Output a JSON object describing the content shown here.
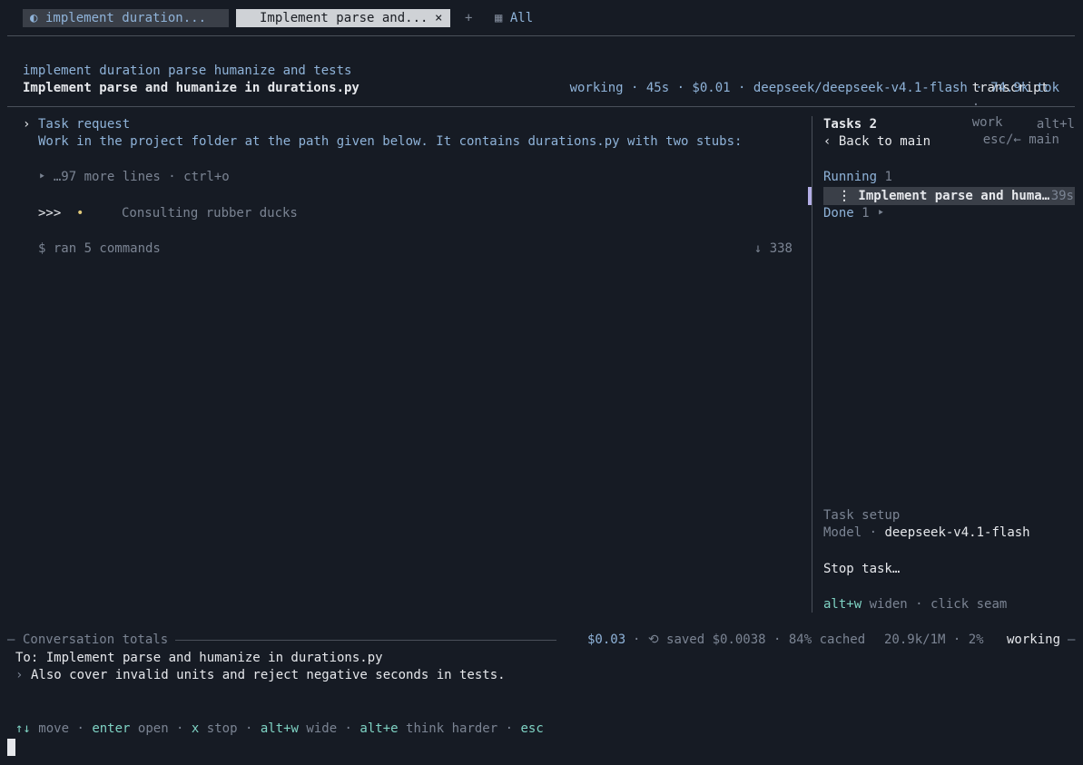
{
  "tabs": [
    {
      "icon": "◐",
      "label": "implement duration..."
    },
    {
      "label": "Implement parse and...",
      "close": "×"
    }
  ],
  "tab_add": "+",
  "tab_all": {
    "icon": "▦",
    "label": "All"
  },
  "header": {
    "task_title": "implement duration parse humanize and tests",
    "task_subtitle": "Implement parse and humanize in durations.py",
    "view_active": "transcript",
    "sep": "·",
    "view_other": "work",
    "back_hint": "esc/← main",
    "status": "working · 45s · $0.01 · deepseek/deepseek-v4.1-flash · 74.9k tok"
  },
  "transcript": {
    "request_marker": "›",
    "request_title": "Task request",
    "request_body": "Work in the project folder at the path given below. It contains durations.py with two stubs:",
    "more_lines": "‣ …97 more lines · ctrl+o",
    "prompt": ">>>",
    "spinner": "•",
    "activity": "Consulting rubber ducks",
    "commands": "$ ran 5 commands",
    "commands_count": "↓ 338"
  },
  "sidebar": {
    "title": "Tasks 2",
    "shortcut": "alt+l",
    "back": "‹ Back to main",
    "running_label": "Running",
    "running_count": "1",
    "running_task": "⋮ Implement parse and huma…",
    "running_time": "39s",
    "done_label": "Done",
    "done_count": "1 ‣",
    "setup_title": "Task setup",
    "model_label": "Model ·",
    "model_value": "deepseek-v4.1-flash",
    "stop": "Stop task…",
    "widen_key": "alt+w",
    "widen_text": "widen · click seam"
  },
  "totals": {
    "label": "Conversation totals",
    "cost": "$0.03",
    "saved": "· ⟲ saved $0.0038 · 84% cached",
    "tokens": "20.9k/1M · 2%",
    "status": "working"
  },
  "composer": {
    "to": "To: Implement parse and humanize in durations.py",
    "marker": "›",
    "message": "Also cover invalid units and reject negative seconds in tests."
  },
  "hints": {
    "move_key": "↑↓",
    "move": "move ·",
    "enter_key": "enter",
    "enter": "open ·",
    "x_key": "x",
    "x": "stop ·",
    "altw_key": "alt+w",
    "altw": "wide ·",
    "alte_key": "alt+e",
    "alte": "think harder ·",
    "esc_key": "esc"
  }
}
